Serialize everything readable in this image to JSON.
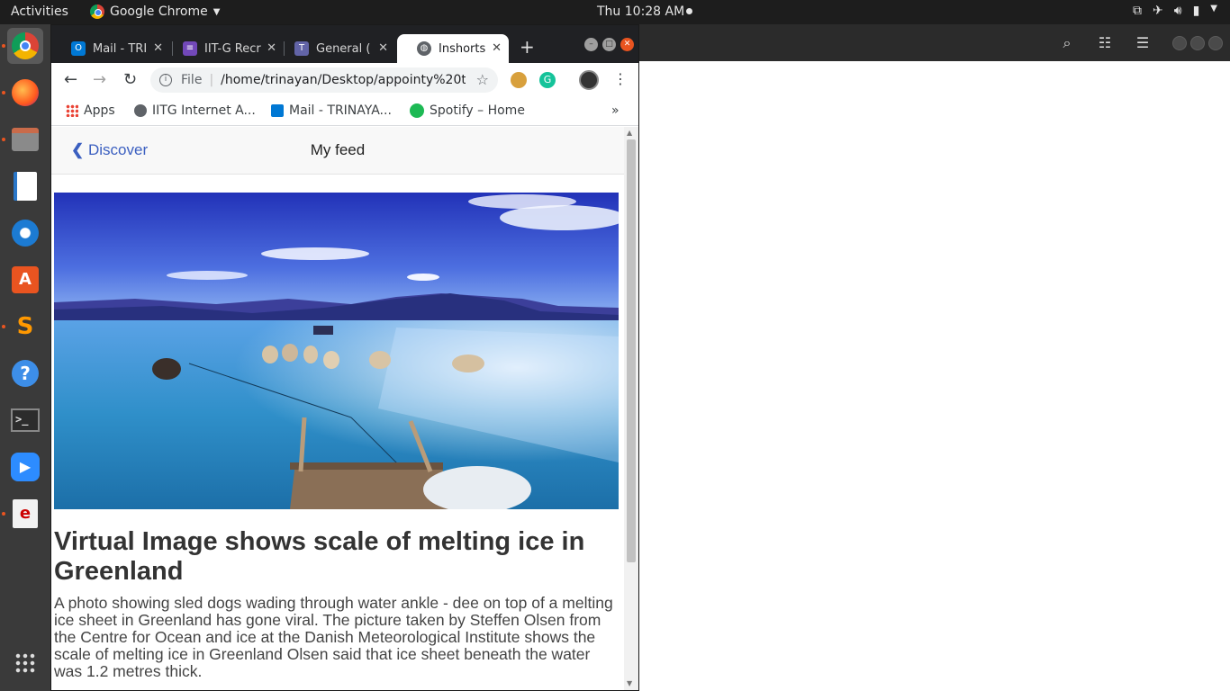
{
  "topbar": {
    "activities": "Activities",
    "app_name": "Google Chrome",
    "clock": "Thu 10:28 AM"
  },
  "tabs": [
    {
      "label": "Mail - TRI",
      "icon": "outlook-icon",
      "color": "#0078d4"
    },
    {
      "label": "IIT-G Recr",
      "icon": "forms-icon",
      "color": "#7248b9"
    },
    {
      "label": "General (",
      "icon": "teams-icon",
      "color": "#6264a7"
    },
    {
      "label": "Inshorts",
      "icon": "globe-icon",
      "color": "#5f6368"
    }
  ],
  "omnibox": {
    "scheme": "File",
    "url": "/home/trinayan/Desktop/appointy%20te..."
  },
  "bookmarks": [
    {
      "label": "Apps"
    },
    {
      "label": "IITG Internet A..."
    },
    {
      "label": "Mail - TRINAYA..."
    },
    {
      "label": "Spotify – Home"
    }
  ],
  "page": {
    "back_label": "Discover",
    "title": "My feed",
    "headline": "Virtual Image shows scale of melting ice in Greenland",
    "summary": "A photo showing sled dogs wading through water ankle - dee on top of a melting ice sheet in Greenland has gone viral. The picture taken by Steffen Olsen from the Centre for Ocean and ice at the Danish Meteorological Institute shows the scale of melting ice in Greenland Olsen said that ice sheet beneath the water was 1.2 metres thick."
  },
  "colors": {
    "link": "#3b5fc0",
    "ubuntu_accent": "#e95420"
  }
}
